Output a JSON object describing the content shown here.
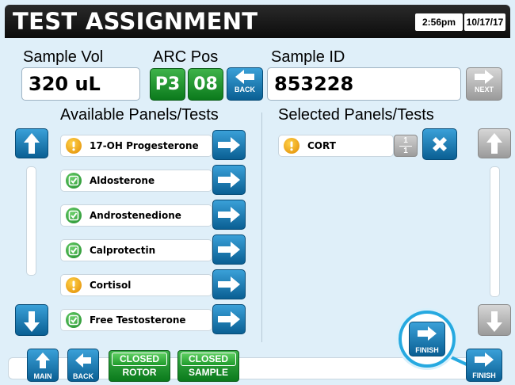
{
  "header": {
    "title": "TEST ASSIGNMENT",
    "time": "2:56pm",
    "date": "10/17/17"
  },
  "sample": {
    "vol_label": "Sample Vol",
    "vol_value": "320 uL",
    "arc_label": "ARC Pos",
    "arc_rack": "P3",
    "arc_slot": "08",
    "back_label": "BACK",
    "id_label": "Sample ID",
    "id_value": "853228",
    "next_label": "NEXT"
  },
  "available": {
    "title": "Available Panels/Tests",
    "items": [
      {
        "label": "17-OH Progesterone",
        "status": "warning"
      },
      {
        "label": "Aldosterone",
        "status": "ok"
      },
      {
        "label": "Androstenedione",
        "status": "ok"
      },
      {
        "label": "Calprotectin",
        "status": "ok"
      },
      {
        "label": "Cortisol",
        "status": "warning"
      },
      {
        "label": "Free Testosterone",
        "status": "ok"
      }
    ]
  },
  "selected": {
    "title": "Selected Panels/Tests",
    "items": [
      {
        "label": "CORT",
        "status": "warning",
        "count_top": "1",
        "count_bottom": "1"
      }
    ]
  },
  "bottom": {
    "main_label": "MAIN",
    "back_label": "BACK",
    "rotor_top": "CLOSED",
    "rotor_bottom": "ROTOR",
    "sample_top": "CLOSED",
    "sample_bottom": "SAMPLE",
    "finish_label": "FINISH",
    "callout_finish_label": "FINISH"
  },
  "colors": {
    "accent_blue": "#0a5f93",
    "accent_green": "#0b7a1c",
    "warning": "#e08a00",
    "callout": "#26a9e0"
  },
  "icons": {
    "up": "arrow-up-icon",
    "down": "arrow-down-icon",
    "right": "arrow-right-icon",
    "left": "arrow-left-icon",
    "remove": "close-x-icon",
    "warning": "exclamation-icon",
    "ok": "checkbox-check-icon"
  }
}
